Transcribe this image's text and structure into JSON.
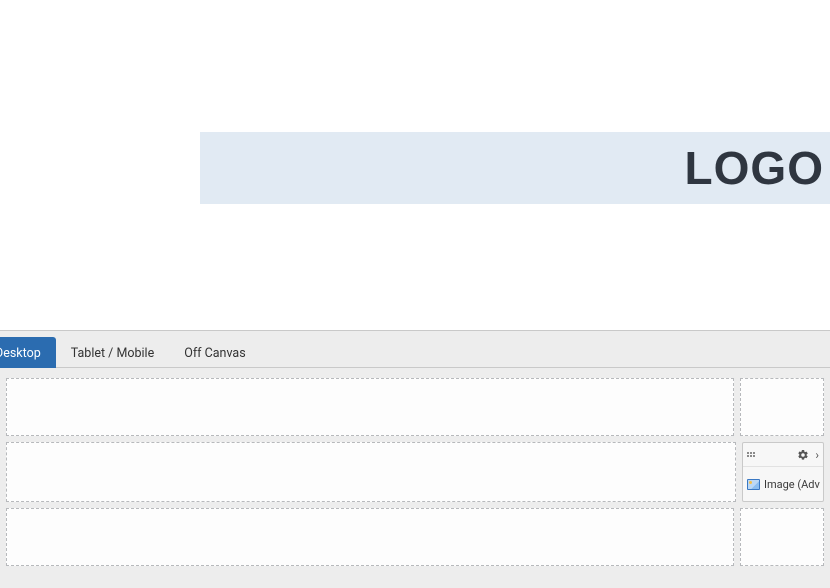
{
  "preview": {
    "logo_text": "LOGO"
  },
  "tabs": {
    "desktop": "Desktop",
    "tablet_mobile": "Tablet / Mobile",
    "off_canvas": "Off Canvas"
  },
  "element": {
    "label": "Image (Adv"
  }
}
